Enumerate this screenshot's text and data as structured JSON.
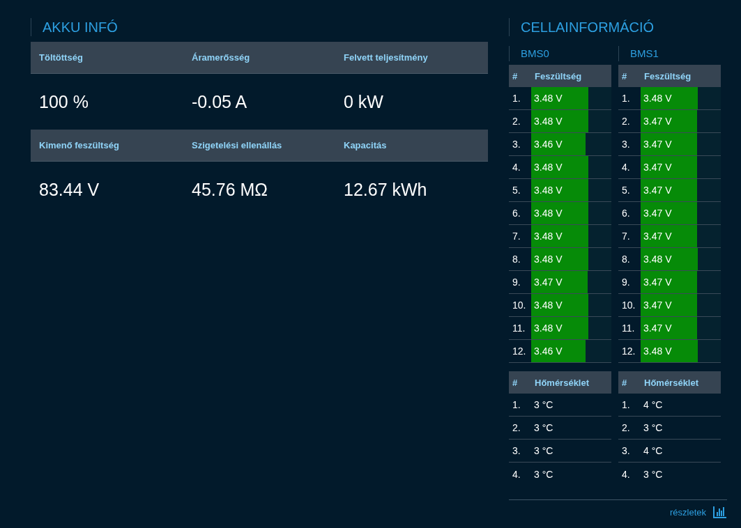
{
  "akku": {
    "title": "AKKU INFÓ",
    "groups": [
      {
        "items": [
          {
            "label": "Töltöttség",
            "value": "100 %"
          },
          {
            "label": "Áramerősség",
            "value": "-0.05 A"
          },
          {
            "label": "Felvett teljesítmény",
            "value": "0 kW"
          }
        ]
      },
      {
        "items": [
          {
            "label": "Kimenő feszültség",
            "value": "83.44 V"
          },
          {
            "label": "Szigetelési ellenállás",
            "value": "45.76 MΩ"
          },
          {
            "label": "Kapacitás",
            "value": "12.67 kWh"
          }
        ]
      }
    ]
  },
  "cells": {
    "title": "CELLAINFORMÁCIÓ",
    "bms": [
      {
        "name": "BMS0",
        "voltage_header": [
          "#",
          "Feszültség"
        ],
        "voltages": [
          {
            "index": "1.",
            "value": "3.48 V",
            "level": 0.71
          },
          {
            "index": "2.",
            "value": "3.48 V",
            "level": 0.71
          },
          {
            "index": "3.",
            "value": "3.46 V",
            "level": 0.68
          },
          {
            "index": "4.",
            "value": "3.48 V",
            "level": 0.71
          },
          {
            "index": "5.",
            "value": "3.48 V",
            "level": 0.71
          },
          {
            "index": "6.",
            "value": "3.48 V",
            "level": 0.71
          },
          {
            "index": "7.",
            "value": "3.48 V",
            "level": 0.71
          },
          {
            "index": "8.",
            "value": "3.48 V",
            "level": 0.71
          },
          {
            "index": "9.",
            "value": "3.47 V",
            "level": 0.7
          },
          {
            "index": "10.",
            "value": "3.48 V",
            "level": 0.71
          },
          {
            "index": "11.",
            "value": "3.48 V",
            "level": 0.71
          },
          {
            "index": "12.",
            "value": "3.46 V",
            "level": 0.68
          }
        ],
        "temp_header": [
          "#",
          "Hőmérséklet"
        ],
        "temps": [
          {
            "index": "1.",
            "value": "3 °C"
          },
          {
            "index": "2.",
            "value": "3 °C"
          },
          {
            "index": "3.",
            "value": "3 °C"
          },
          {
            "index": "4.",
            "value": "3 °C"
          }
        ]
      },
      {
        "name": "BMS1",
        "voltage_header": [
          "#",
          "Feszültség"
        ],
        "voltages": [
          {
            "index": "1.",
            "value": "3.48 V",
            "level": 0.71
          },
          {
            "index": "2.",
            "value": "3.47 V",
            "level": 0.7
          },
          {
            "index": "3.",
            "value": "3.47 V",
            "level": 0.7
          },
          {
            "index": "4.",
            "value": "3.47 V",
            "level": 0.7
          },
          {
            "index": "5.",
            "value": "3.47 V",
            "level": 0.7
          },
          {
            "index": "6.",
            "value": "3.47 V",
            "level": 0.7
          },
          {
            "index": "7.",
            "value": "3.47 V",
            "level": 0.7
          },
          {
            "index": "8.",
            "value": "3.48 V",
            "level": 0.71
          },
          {
            "index": "9.",
            "value": "3.47 V",
            "level": 0.7
          },
          {
            "index": "10.",
            "value": "3.47 V",
            "level": 0.7
          },
          {
            "index": "11.",
            "value": "3.47 V",
            "level": 0.7
          },
          {
            "index": "12.",
            "value": "3.48 V",
            "level": 0.71
          }
        ],
        "temp_header": [
          "#",
          "Hőmérséklet"
        ],
        "temps": [
          {
            "index": "1.",
            "value": "4 °C"
          },
          {
            "index": "2.",
            "value": "3 °C"
          },
          {
            "index": "3.",
            "value": "4 °C"
          },
          {
            "index": "4.",
            "value": "3 °C"
          }
        ]
      }
    ]
  },
  "details_link": "részletek"
}
